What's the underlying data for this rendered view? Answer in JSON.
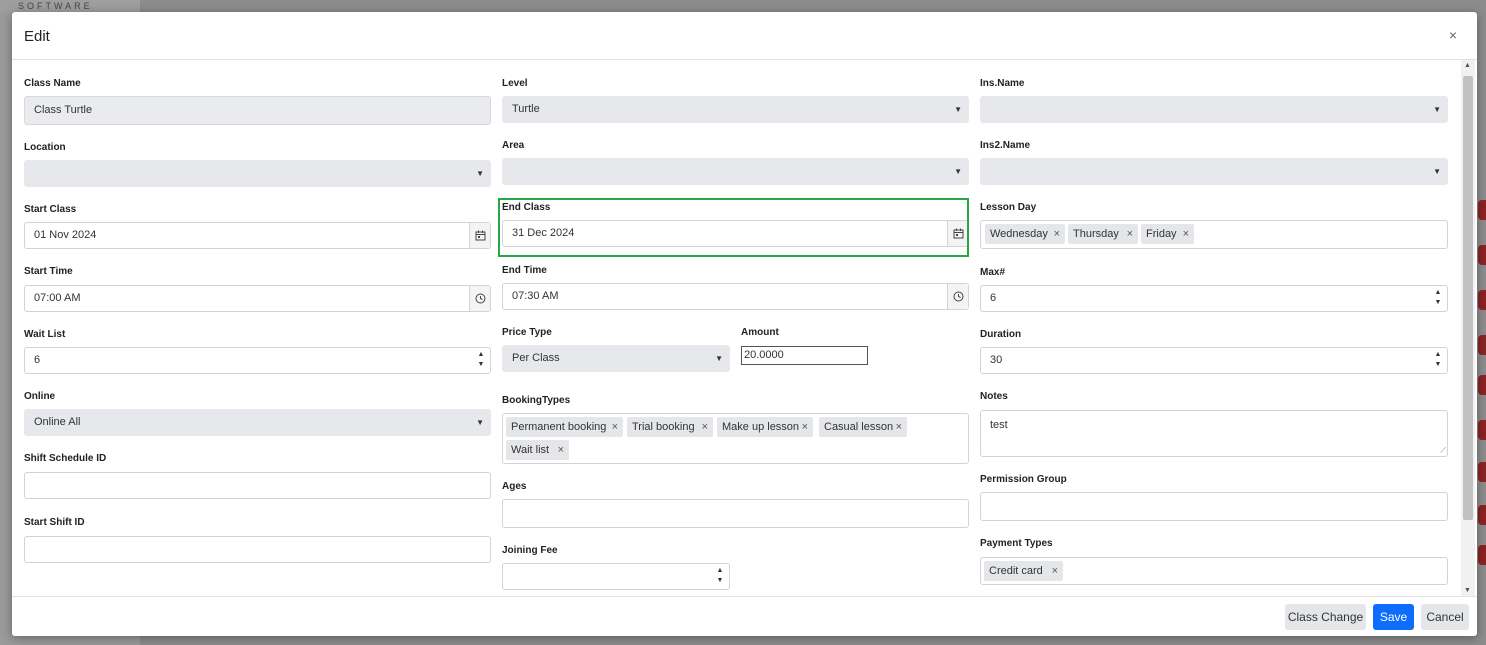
{
  "background": {
    "logo_text": "SOFTWARE"
  },
  "modal": {
    "title": "Edit",
    "close_glyph": "×"
  },
  "form": {
    "class_name": {
      "label": "Class Name",
      "value": "Class Turtle"
    },
    "level": {
      "label": "Level",
      "value": "Turtle"
    },
    "ins_name": {
      "label": "Ins.Name",
      "value": ""
    },
    "location": {
      "label": "Location",
      "value": ""
    },
    "area": {
      "label": "Area",
      "value": ""
    },
    "ins2_name": {
      "label": "Ins2.Name",
      "value": ""
    },
    "start_class": {
      "label": "Start Class",
      "value": "01 Nov 2024",
      "icon": "calendar-icon"
    },
    "end_class": {
      "label": "End Class",
      "value": "31 Dec 2024",
      "icon": "calendar-icon"
    },
    "lesson_day": {
      "label": "Lesson Day",
      "tags": [
        "Wednesday",
        "Thursday",
        "Friday"
      ]
    },
    "start_time": {
      "label": "Start Time",
      "value": "07:00 AM",
      "icon": "clock-icon"
    },
    "end_time": {
      "label": "End Time",
      "value": "07:30 AM",
      "icon": "clock-icon"
    },
    "max": {
      "label": "Max#",
      "value": "6"
    },
    "wait_list": {
      "label": "Wait List",
      "value": "6"
    },
    "price_type": {
      "label": "Price Type",
      "value": "Per Class"
    },
    "amount": {
      "label": "Amount",
      "value": "20.0000"
    },
    "duration": {
      "label": "Duration",
      "value": "30"
    },
    "online": {
      "label": "Online",
      "value": "Online All"
    },
    "booking_types": {
      "label": "BookingTypes",
      "tags": [
        "Permanent booking",
        "Trial booking",
        "Make up lesson",
        "Casual lesson",
        "Wait list"
      ]
    },
    "notes": {
      "label": "Notes",
      "value": "test"
    },
    "shift_schedule_id": {
      "label": "Shift Schedule ID",
      "value": ""
    },
    "ages": {
      "label": "Ages",
      "value": ""
    },
    "permission_group": {
      "label": "Permission Group",
      "value": ""
    },
    "start_shift_id": {
      "label": "Start Shift ID",
      "value": ""
    },
    "joining_fee": {
      "label": "Joining Fee",
      "value": ""
    },
    "payment_types": {
      "label": "Payment Types",
      "tags": [
        "Credit card"
      ]
    }
  },
  "footer": {
    "class_change_label": "Class Change",
    "save_label": "Save",
    "cancel_label": "Cancel"
  },
  "colors": {
    "primary": "#0d6efd",
    "highlight": "#28a745",
    "select_bg": "#e6e8eb"
  },
  "tag_remove_glyph": "×"
}
